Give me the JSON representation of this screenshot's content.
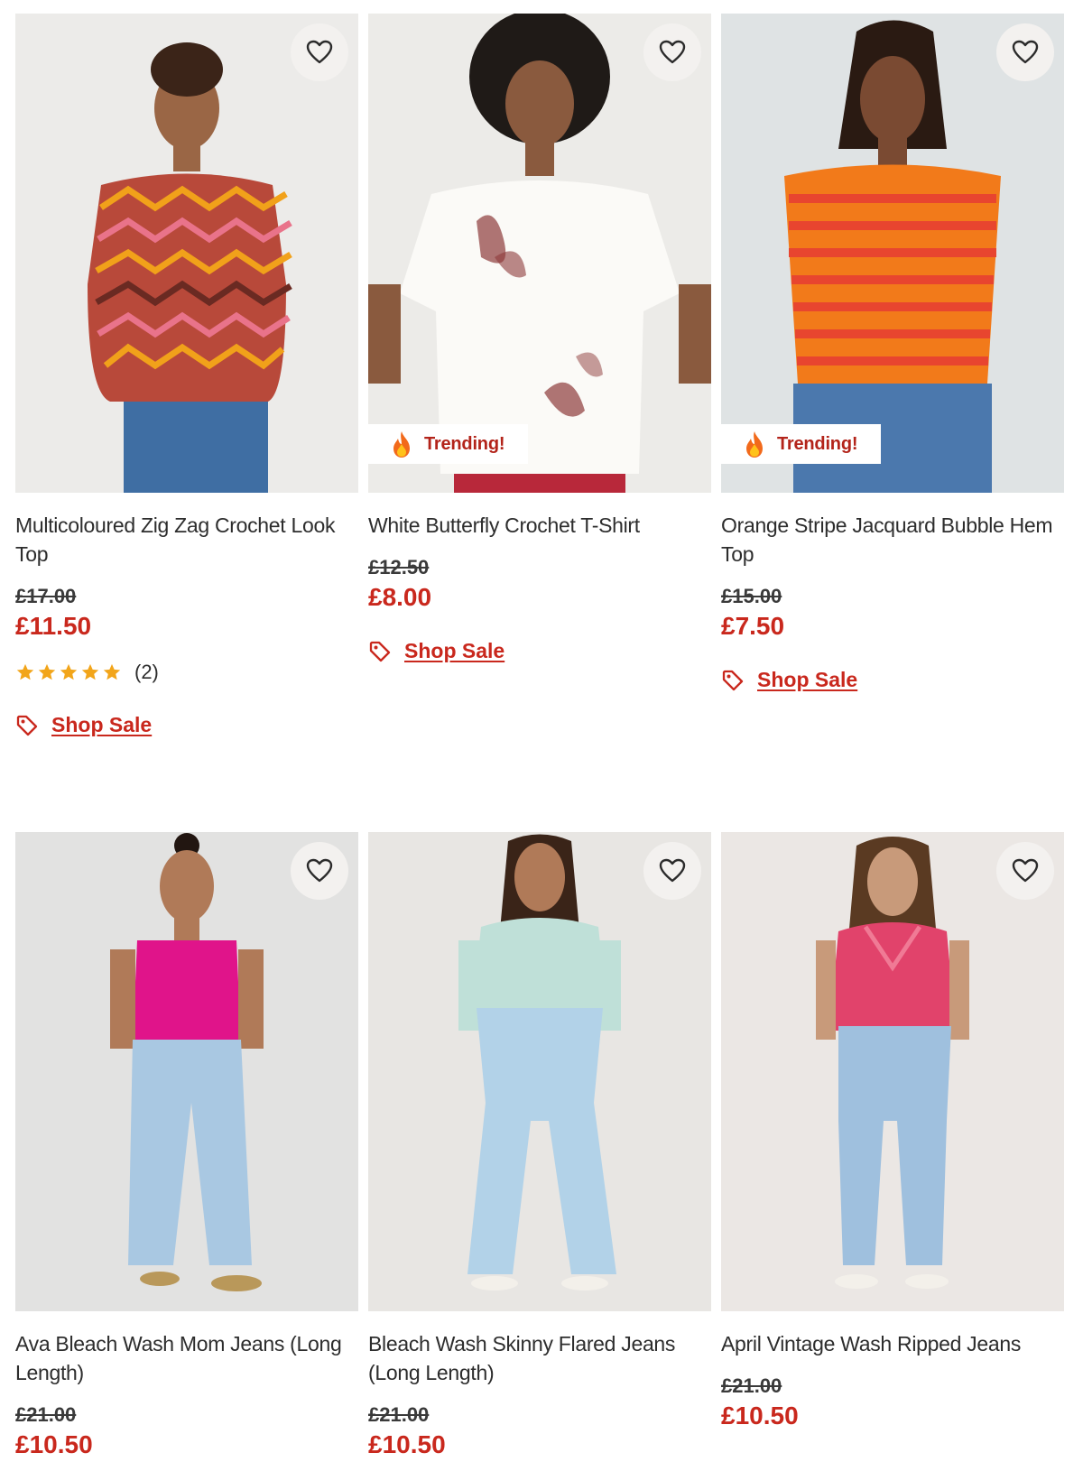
{
  "products": [
    {
      "title": "Multicoloured Zig Zag Crochet Look Top",
      "was_price": "£17.00",
      "now_price": "£11.50",
      "rating_stars": 5,
      "rating_count": "(2)",
      "badge": "",
      "link": "Shop Sale",
      "photo_description": "model in multicoloured zig zag top and blue jeans",
      "wishlist_icon": "heart-icon"
    },
    {
      "title": "White Butterfly Crochet T-Shirt",
      "was_price": "£12.50",
      "now_price": "£8.00",
      "badge": "Trending!",
      "link": "Shop Sale",
      "wishlist_icon": "heart-icon"
    },
    {
      "title": "Orange Stripe Jacquard Bubble Hem Top",
      "was_price": "£15.00",
      "now_price": "£7.50",
      "badge": "Trending!",
      "link": "Shop Sale",
      "wishlist_icon": "heart-icon"
    },
    {
      "title": "Ava Bleach Wash Mom Jeans (Long Length)",
      "was_price": "£21.00",
      "now_price": "£10.50",
      "wishlist_icon": "heart-icon"
    },
    {
      "title": "Bleach Wash Skinny Flared Jeans (Long Length)",
      "was_price": "£21.00",
      "now_price": "£10.50",
      "wishlist_icon": "heart-icon"
    },
    {
      "title": "April Vintage Wash Ripped Jeans",
      "was_price": "£21.00",
      "now_price": "£10.50",
      "wishlist_icon": "heart-icon"
    }
  ],
  "colors": {
    "sale_red": "#c9281d",
    "star_gold": "#f2a51a",
    "badge_red": "#b3241a"
  }
}
